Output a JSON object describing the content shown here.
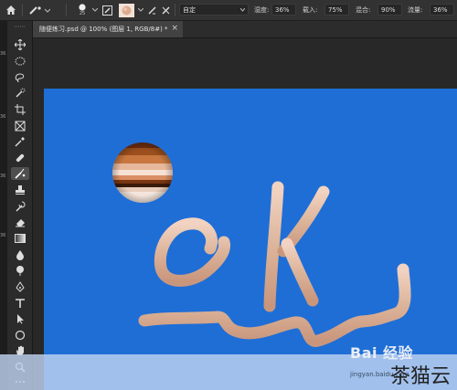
{
  "options_bar": {
    "brush_size": "25",
    "mode_value": "自定",
    "fields": [
      {
        "label": "湿度:",
        "value": "36%"
      },
      {
        "label": "载入:",
        "value": "75%"
      },
      {
        "label": "混合:",
        "value": "90%"
      },
      {
        "label": "流量:",
        "value": "36%"
      }
    ]
  },
  "left_edge_labels": [
    "36",
    "36",
    "36",
    "36"
  ],
  "document_tab": {
    "title": "随便练习.psd @ 100% (图层 1, RGB/8#) *",
    "close": "×"
  },
  "canvas": {
    "background_color": "#1f6ed6",
    "paint_color": "#dcb49a"
  },
  "tools": [
    "move-tool",
    "marquee-tool",
    "lasso-tool",
    "quick-select-tool",
    "crop-tool",
    "frame-tool",
    "eyedropper-tool",
    "healing-brush-tool",
    "mixer-brush-tool",
    "clone-stamp-tool",
    "history-brush-tool",
    "eraser-tool",
    "gradient-tool",
    "blur-tool",
    "dodge-tool",
    "pen-tool",
    "type-tool",
    "path-select-tool",
    "rectangle-tool",
    "hand-tool",
    "zoom-tool",
    "more-tools"
  ],
  "watermark": {
    "logo": "Bai 经验",
    "url": "jingyan.baidu.com",
    "corner_text": "茶猫云"
  }
}
